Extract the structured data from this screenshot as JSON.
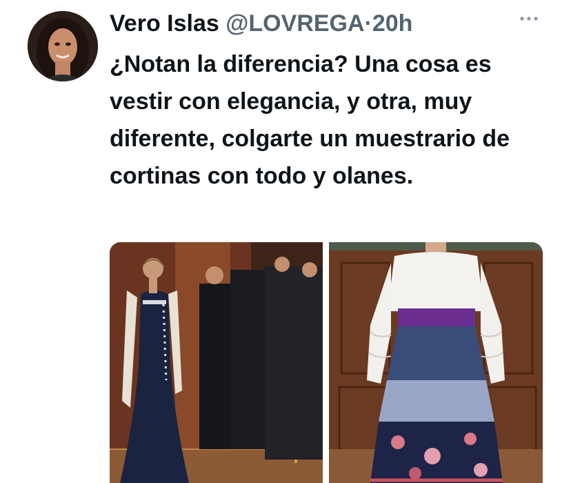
{
  "tweet": {
    "author_name": "Vero Islas",
    "author_handle": "@LOVREGA",
    "separator": "·",
    "timestamp": "20h",
    "more_icon": "ellipsis-icon",
    "text": "¿Notan la diferencia? Una cosa es vestir con elegancia, y otra, muy diferente, colgarte un muestrario de cortinas con todo y olanes."
  },
  "media": {
    "photos": [
      {
        "subject": "woman-navy-gown"
      },
      {
        "subject": "woman-white-blouse-ruffled-skirt"
      }
    ]
  }
}
